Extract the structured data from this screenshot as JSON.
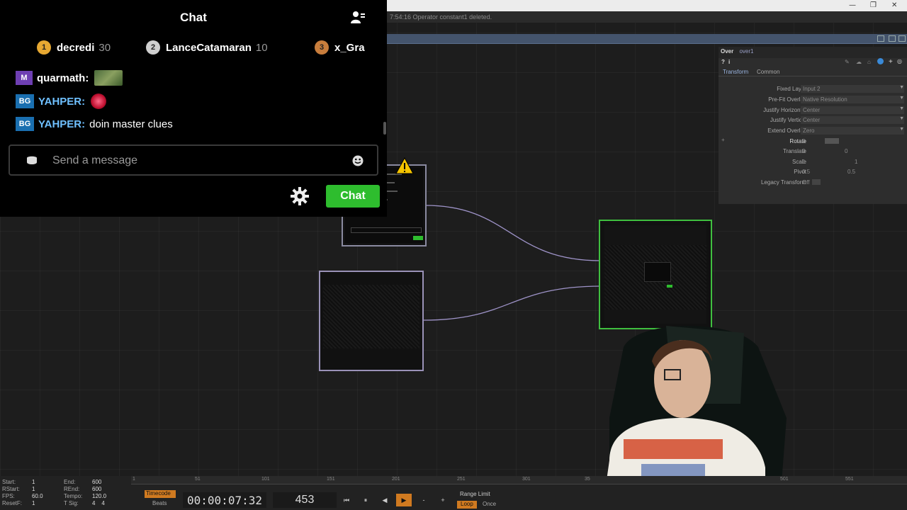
{
  "window": {
    "status_message": "7:54:16 Operator constant1 deleted."
  },
  "chat": {
    "title": "Chat",
    "leaderboard": [
      {
        "rank": "1",
        "name": "decredi",
        "count": "30",
        "color": "#e6a832"
      },
      {
        "rank": "2",
        "name": "LanceCatamaran",
        "count": "10",
        "color": "#cfcfcf"
      },
      {
        "rank": "3",
        "name": "x_Gra",
        "count": "",
        "color": "#c87d3c"
      }
    ],
    "messages": [
      {
        "badge": "M",
        "badge_color": "#6e3fb3",
        "user": "quarmath:",
        "user_color": "#ffffff",
        "text": ""
      },
      {
        "badge": "BG",
        "badge_color": "#1a6fb0",
        "user": "YAHPER:",
        "user_color": "#6fc0ff",
        "text": ""
      },
      {
        "badge": "BG",
        "badge_color": "#1a6fb0",
        "user": "YAHPER:",
        "user_color": "#6fc0ff",
        "text": "doin master clues"
      }
    ],
    "input_placeholder": "Send a message",
    "chat_button": "Chat"
  },
  "params": {
    "op_type": "Over",
    "op_name": "over1",
    "tabs": [
      "Transform",
      "Common"
    ],
    "rows": [
      {
        "label": "Fixed Layer",
        "value": "Input 2"
      },
      {
        "label": "Pre-Fit Overlay",
        "value": "Native Resolution"
      },
      {
        "label": "Justify Horizontal",
        "value": "Center"
      },
      {
        "label": "Justify Vertical",
        "value": "Center"
      },
      {
        "label": "Extend Overlay",
        "value": "Zero"
      },
      {
        "label": "Rotate",
        "value": "0"
      },
      {
        "label": "Translate",
        "value": "0",
        "value2": "0"
      },
      {
        "label": "Scale",
        "value": "1",
        "value2": "1"
      },
      {
        "label": "Pivot",
        "value": "0.5",
        "value2": "0.5"
      },
      {
        "label": "Legacy Transform",
        "value": "Off"
      }
    ]
  },
  "timeline": {
    "start_label": "Start:",
    "start": "1",
    "rstart_label": "RStart:",
    "rstart": "1",
    "fps_label": "FPS:",
    "fps": "60.0",
    "resetf_label": "ResetF:",
    "resetf": "1",
    "end_label": "End:",
    "end": "600",
    "rend_label": "REnd:",
    "rend": "600",
    "tempo_label": "Tempo:",
    "tempo": "120.0",
    "tsig_label": "T Sig:",
    "tsig": "4    4",
    "timecode_label": "Timecode",
    "beats_label": "Beats",
    "timecode": "00:00:07:32",
    "frame": "453",
    "range_limit": "Range Limit",
    "loop": "Loop",
    "once": "Once",
    "ticks": [
      "1",
      "51",
      "101",
      "151",
      "201",
      "251",
      "301",
      "35",
      "501",
      "551"
    ]
  }
}
